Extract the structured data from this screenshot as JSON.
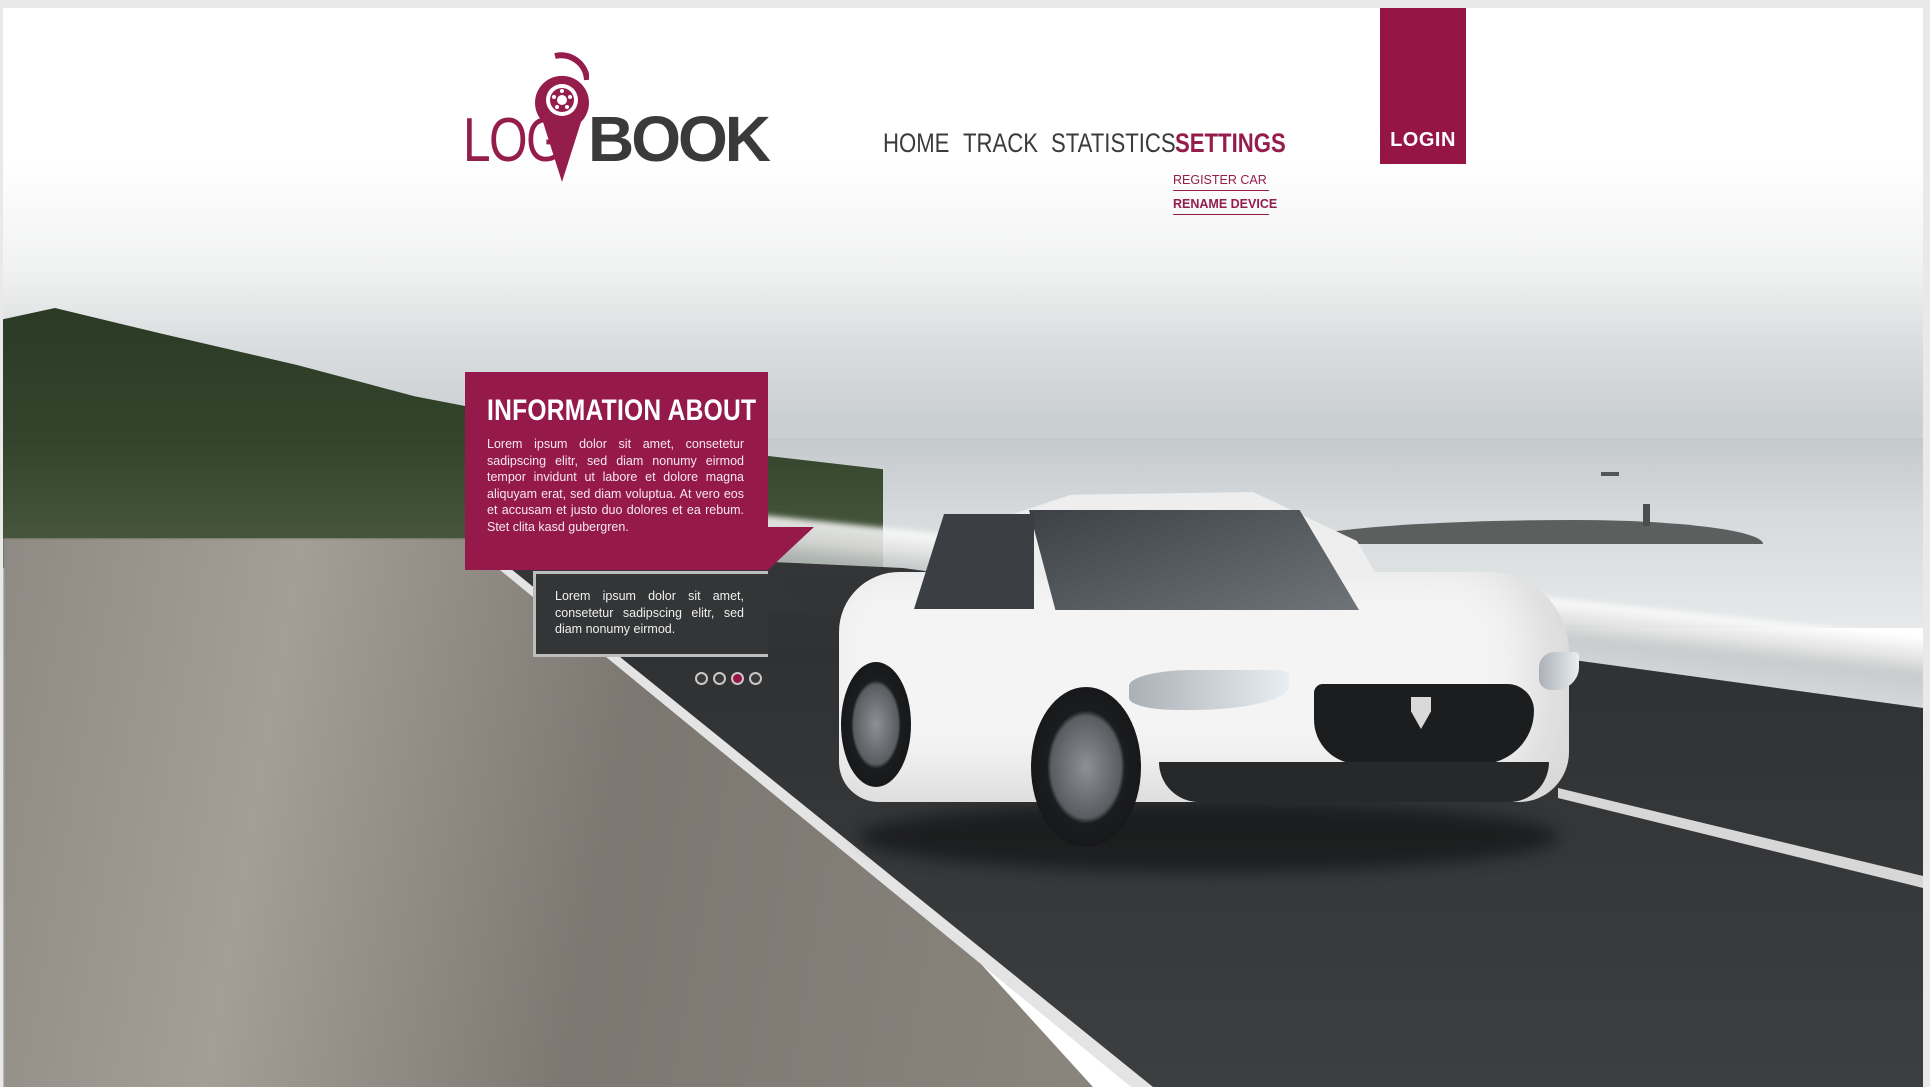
{
  "brand": {
    "logo_part1": "LOG",
    "logo_part2": "BOOK",
    "primary_color": "#951545",
    "dark_color": "#3a3a3b"
  },
  "nav": {
    "items": [
      {
        "label": "HOME",
        "active": false
      },
      {
        "label": "TRACK",
        "active": false
      },
      {
        "label": "STATISTICS",
        "active": false
      },
      {
        "label": "SETTINGS",
        "active": true
      }
    ],
    "settings_submenu": [
      {
        "label": "REGISTER CAR"
      },
      {
        "label": "RENAME DEVICE"
      }
    ]
  },
  "login": {
    "label": "LOGIN"
  },
  "hero": {
    "info_title": "INFORMATION ABOUT",
    "info_text": "Lorem ipsum dolor sit amet, consetetur sadipscing elitr, sed diam nonumy eirmod tempor invidunt ut labore et dolore magna aliquyam erat, sed diam voluptua. At vero eos et accusam et justo duo dolores et ea rebum. Stet clita kasd gubergren.",
    "sub_text": "Lorem ipsum dolor sit amet, consetetur sadipscing elitr, sed diam nonumy eirmod.",
    "slides": {
      "count": 4,
      "active_index": 2
    }
  },
  "icons": {
    "logo_pin": "map-pin-with-brake-disc-icon"
  }
}
